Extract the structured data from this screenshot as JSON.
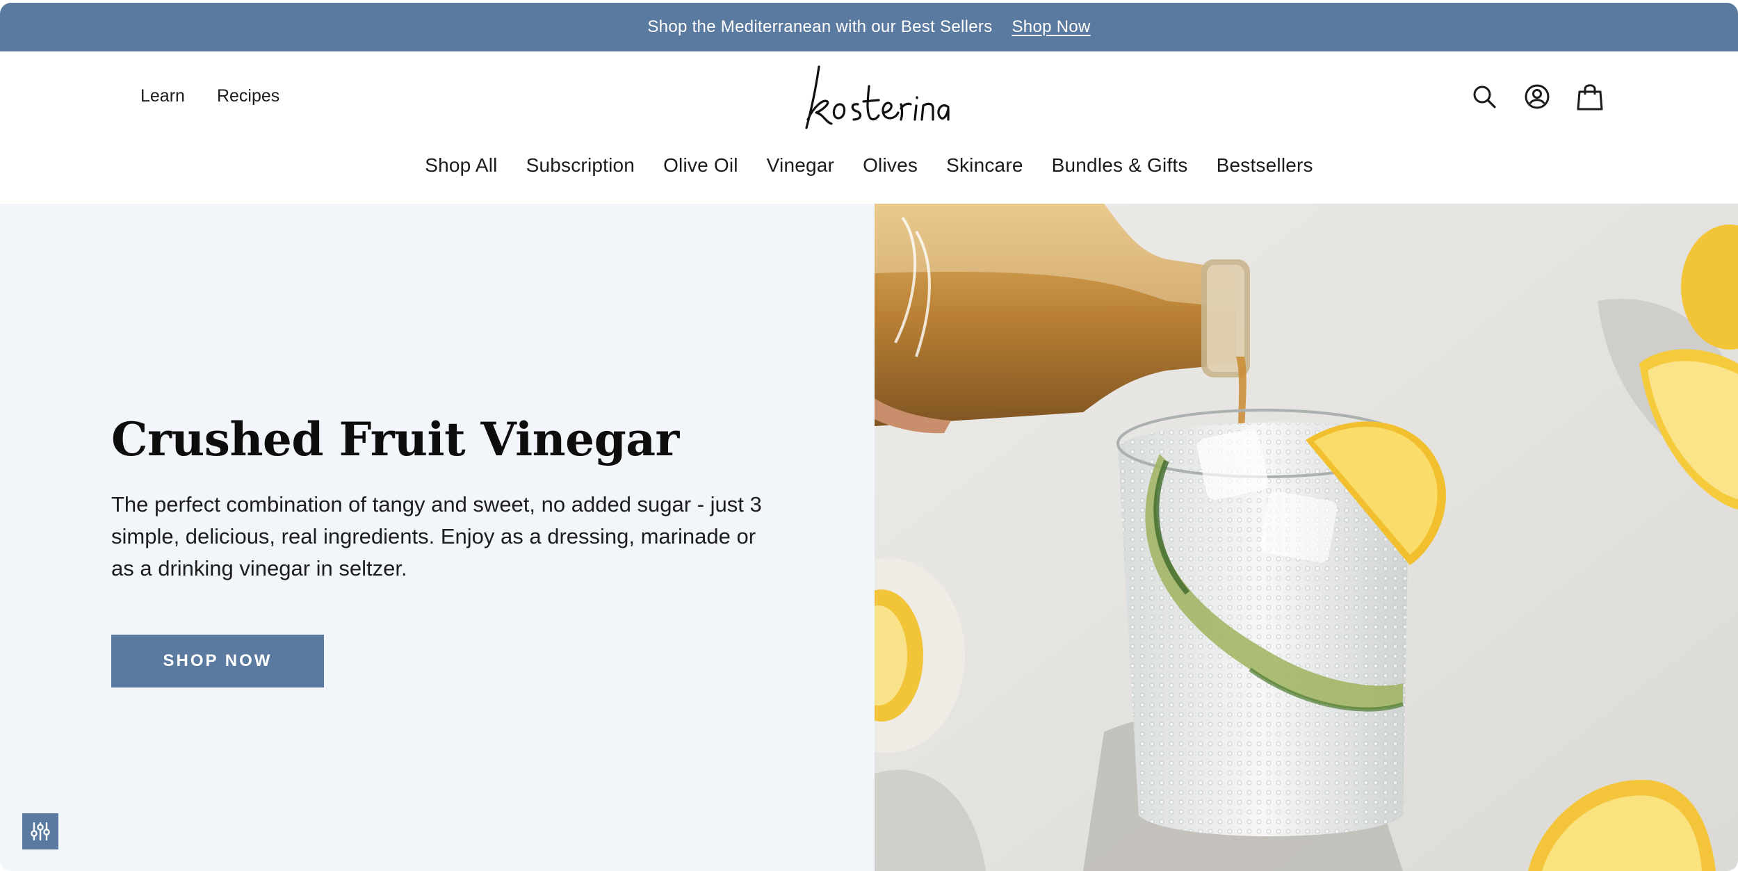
{
  "announcement": {
    "text": "Shop the Mediterranean with our Best Sellers",
    "link": "Shop Now"
  },
  "header": {
    "util_links": [
      "Learn",
      "Recipes"
    ],
    "logo_text": "kosterina",
    "icons": [
      "search-icon",
      "account-icon",
      "cart-icon"
    ]
  },
  "nav": {
    "items": [
      "Shop All",
      "Subscription",
      "Olive Oil",
      "Vinegar",
      "Olives",
      "Skincare",
      "Bundles & Gifts",
      "Bestsellers"
    ]
  },
  "hero": {
    "title": "Crushed Fruit Vinegar",
    "description": "The perfect combination of tangy and sweet, no added sugar - just 3 simple, delicious, real ingredients. Enjoy as a dressing, marinade or as a drinking vinegar in seltzer.",
    "button": "SHOP NOW"
  },
  "colors": {
    "accent": "#5b7a9f",
    "hero_bg": "#f2f5fa",
    "text": "#0d0d0d"
  }
}
